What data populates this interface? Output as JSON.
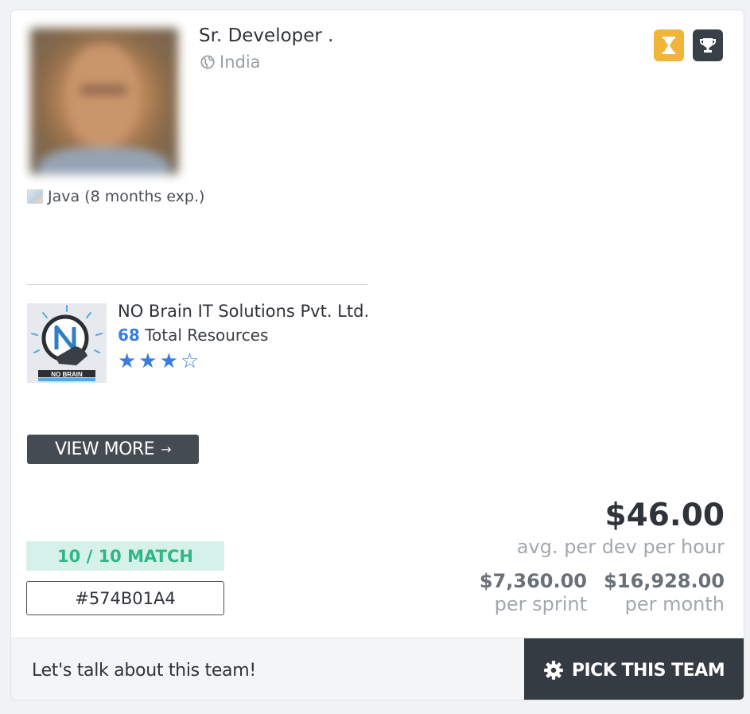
{
  "profile": {
    "title": "Sr. Developer .",
    "location": "India",
    "photo_icon": "avatar-photo",
    "skill": "Java (8 months exp.)"
  },
  "badges": {
    "hourglass_icon": "hourglass-icon",
    "trophy_icon": "trophy-icon",
    "hourglass_color": "#f2b53a",
    "trophy_color": "#3a4047"
  },
  "company": {
    "name": "NO Brain IT Solutions Pvt. Ltd.",
    "resources_count": "68",
    "resources_label": "Total Resources",
    "stars_display": "★★★☆",
    "rating": 3,
    "rating_max": 4,
    "logo_text": "NO BRAIN"
  },
  "actions": {
    "view_more_label": "VIEW MORE",
    "view_more_arrow": "→",
    "talk_label": "Let's talk about this team!",
    "pick_label": "PICK THIS TEAM"
  },
  "match": {
    "label": "10 / 10 MATCH",
    "code": "#574B01A4"
  },
  "pricing": {
    "avg_price": "$46.00",
    "avg_label": "avg. per dev per hour",
    "sprint_price": "$7,360.00",
    "sprint_label": "per sprint",
    "month_price": "$16,928.00",
    "month_label": "per month"
  },
  "colors": {
    "accent_blue": "#3b7ddd",
    "match_green": "#2fb685",
    "dark_button": "#353b42"
  }
}
